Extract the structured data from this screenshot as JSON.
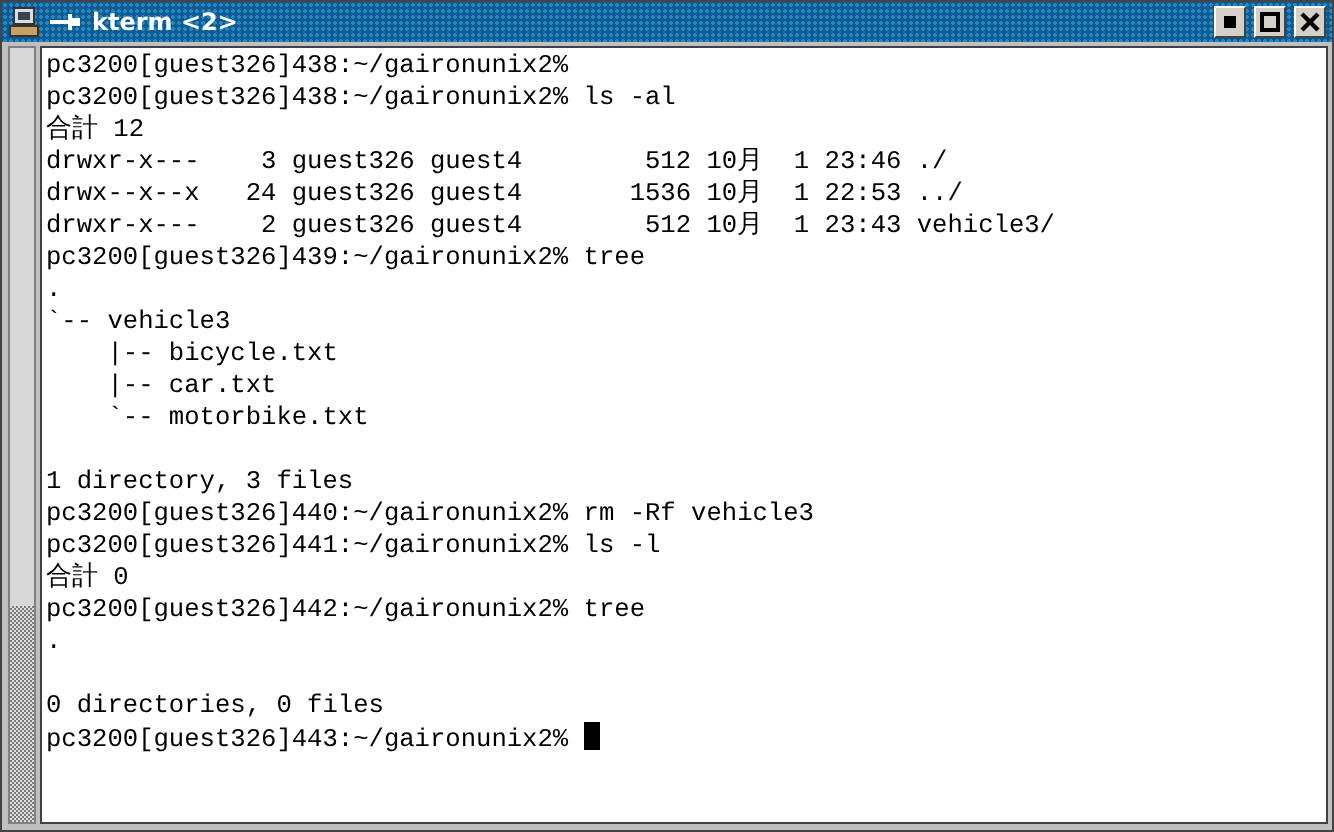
{
  "window": {
    "title": "kterm <2>"
  },
  "terminal": {
    "lines": [
      {
        "kind": "text",
        "text": "pc3200[guest326]438:~/gaironunix2%"
      },
      {
        "kind": "text",
        "text": "pc3200[guest326]438:~/gaironunix2% ls -al"
      },
      {
        "kind": "text",
        "text": "合計 12"
      },
      {
        "kind": "text",
        "text": "drwxr-x---    3 guest326 guest4        512 10月  1 23:46 ./"
      },
      {
        "kind": "text",
        "text": "drwx--x--x   24 guest326 guest4       1536 10月  1 22:53 ../"
      },
      {
        "kind": "text",
        "text": "drwxr-x---    2 guest326 guest4        512 10月  1 23:43 vehicle3/"
      },
      {
        "kind": "text",
        "text": "pc3200[guest326]439:~/gaironunix2% tree"
      },
      {
        "kind": "text",
        "text": "."
      },
      {
        "kind": "text",
        "text": "`-- vehicle3"
      },
      {
        "kind": "text",
        "text": "    |-- bicycle.txt"
      },
      {
        "kind": "text",
        "text": "    |-- car.txt"
      },
      {
        "kind": "text",
        "text": "    `-- motorbike.txt"
      },
      {
        "kind": "blank"
      },
      {
        "kind": "text",
        "text": "1 directory, 3 files"
      },
      {
        "kind": "text",
        "text": "pc3200[guest326]440:~/gaironunix2% rm -Rf vehicle3"
      },
      {
        "kind": "text",
        "text": "pc3200[guest326]441:~/gaironunix2% ls -l"
      },
      {
        "kind": "text",
        "text": "合計 0"
      },
      {
        "kind": "text",
        "text": "pc3200[guest326]442:~/gaironunix2% tree"
      },
      {
        "kind": "text",
        "text": "."
      },
      {
        "kind": "blank"
      },
      {
        "kind": "text",
        "text": "0 directories, 0 files"
      },
      {
        "kind": "text",
        "text": "pc3200[guest326]443:~/gaironunix2% ",
        "cursor": true
      }
    ]
  }
}
